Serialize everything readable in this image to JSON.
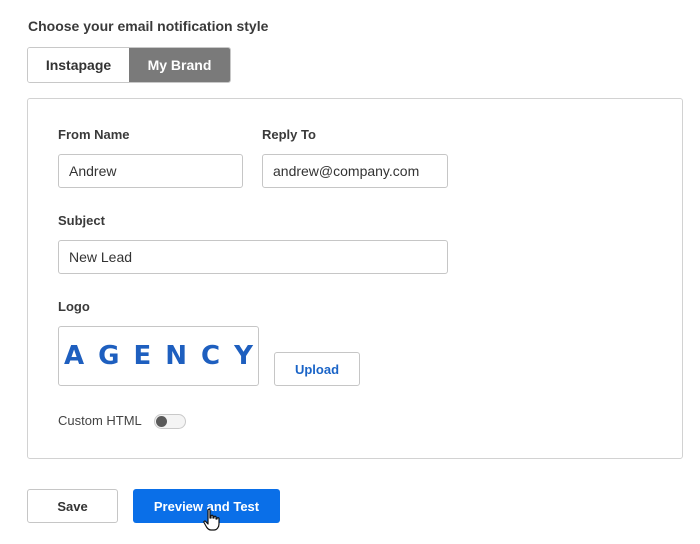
{
  "heading": "Choose your email notification style",
  "style_tabs": {
    "items": [
      {
        "label": "Instapage",
        "active": false
      },
      {
        "label": "My Brand",
        "active": true
      }
    ]
  },
  "form": {
    "from_name": {
      "label": "From Name",
      "value": "Andrew"
    },
    "reply_to": {
      "label": "Reply To",
      "value": "andrew@company.com"
    },
    "subject": {
      "label": "Subject",
      "value": "New Lead"
    },
    "logo": {
      "label": "Logo",
      "image_text": "AGENCY",
      "image_color": "#1e5fbf"
    },
    "upload_label": "Upload",
    "custom_html": {
      "label": "Custom HTML",
      "enabled": false
    }
  },
  "actions": {
    "save_label": "Save",
    "preview_label": "Preview and Test"
  },
  "colors": {
    "primary": "#0a6fe8",
    "link": "#1a64c7",
    "active_tab": "#7a7a7a"
  },
  "cursor": "hand-pointer-icon"
}
